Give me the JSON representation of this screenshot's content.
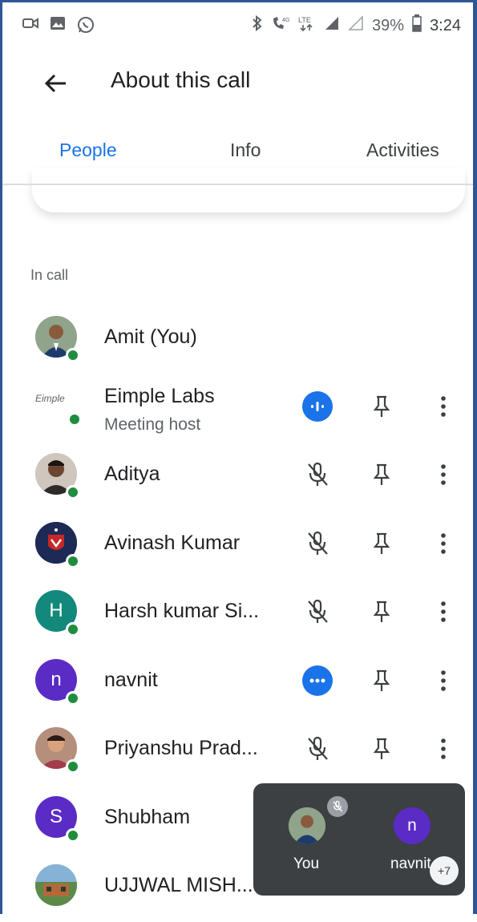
{
  "status_bar": {
    "left_icons": [
      "video-icon",
      "image-icon",
      "whatsapp-icon"
    ],
    "right_icons": [
      "bluetooth-icon",
      "volte-icon",
      "lte-icon",
      "signal-icon",
      "signal-icon-2"
    ],
    "battery": "39%",
    "time": "3:24"
  },
  "header": {
    "title": "About this call",
    "back_icon": "arrow-back-icon"
  },
  "tabs": [
    {
      "label": "People",
      "active": true
    },
    {
      "label": "Info",
      "active": false
    },
    {
      "label": "Activities",
      "active": false
    }
  ],
  "section_label": "In call",
  "participants": [
    {
      "name": "Amit (You)",
      "subtitle": "",
      "avatar": "photo",
      "mic": "none"
    },
    {
      "name": "Eimple Labs",
      "subtitle": "Meeting host",
      "avatar": "Eimple",
      "mic": "speaking"
    },
    {
      "name": "Aditya",
      "subtitle": "",
      "avatar": "photo",
      "mic": "muted"
    },
    {
      "name": "Avinash Kumar",
      "subtitle": "",
      "avatar": "badge",
      "mic": "muted"
    },
    {
      "name": "Harsh kumar Si...",
      "subtitle": "",
      "avatar": "H",
      "mic": "muted"
    },
    {
      "name": "navnit",
      "subtitle": "",
      "avatar": "n",
      "mic": "dots"
    },
    {
      "name": "Priyanshu Prad...",
      "subtitle": "",
      "avatar": "photo",
      "mic": "muted"
    },
    {
      "name": "Shubham",
      "subtitle": "",
      "avatar": "S",
      "mic": "none"
    },
    {
      "name": "UJJWAL MISH...",
      "subtitle": "",
      "avatar": "photo",
      "mic": "none"
    }
  ],
  "pip": {
    "tiles": [
      {
        "label": "You"
      },
      {
        "label": "navnit",
        "initial": "n"
      }
    ],
    "more_count": "+7"
  },
  "colors": {
    "accent": "#1a73e8",
    "presence": "#1e8e3e",
    "teal_avatar": "#12897a",
    "purple_avatar": "#5b2bc5",
    "pip_bg": "#3c4043"
  }
}
